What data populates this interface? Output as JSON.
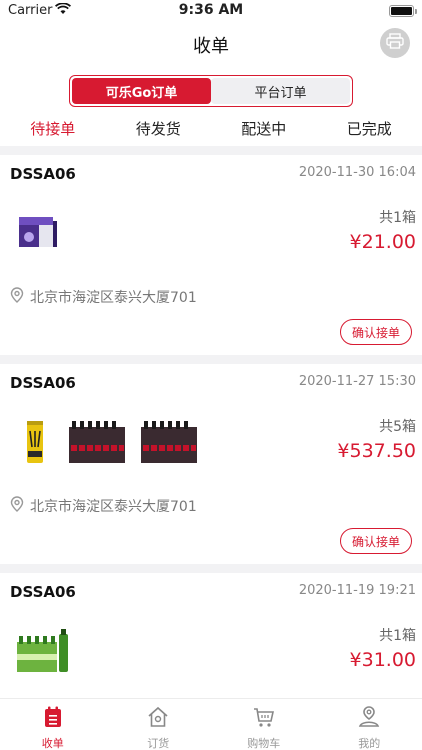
{
  "status_bar": {
    "carrier": "Carrier",
    "time": "9:36 AM"
  },
  "nav": {
    "title": "收单"
  },
  "segment": {
    "items": [
      "可乐Go订单",
      "平台订单"
    ],
    "selected": 0
  },
  "tabs": {
    "items": [
      "待接单",
      "待发货",
      "配送中",
      "已完成"
    ],
    "selected": 0
  },
  "orders": [
    {
      "shop": "DSSA06",
      "date": "2020-11-30 16:04",
      "quantity": "共1箱",
      "price": "¥21.00",
      "address": "北京市海淀区泰兴大厦701",
      "action": "确认接单",
      "products": [
        "purple-box-product"
      ]
    },
    {
      "shop": "DSSA06",
      "date": "2020-11-27 15:30",
      "quantity": "共5箱",
      "price": "¥537.50",
      "address": "北京市海淀区泰兴大厦701",
      "action": "确认接单",
      "products": [
        "monster-energy-can",
        "coke-zero-pack",
        "coke-zero-pack"
      ]
    },
    {
      "shop": "DSSA06",
      "date": "2020-11-19 19:21",
      "quantity": "共1箱",
      "price": "¥31.00",
      "products": [
        "green-tea-pack"
      ]
    }
  ],
  "tabbar": {
    "items": [
      "收单",
      "订货",
      "购物车",
      "我的"
    ],
    "selected": 0
  },
  "colors": {
    "accent": "#d71a31",
    "gray_text": "#888888",
    "separator": "#f2f2f4"
  }
}
